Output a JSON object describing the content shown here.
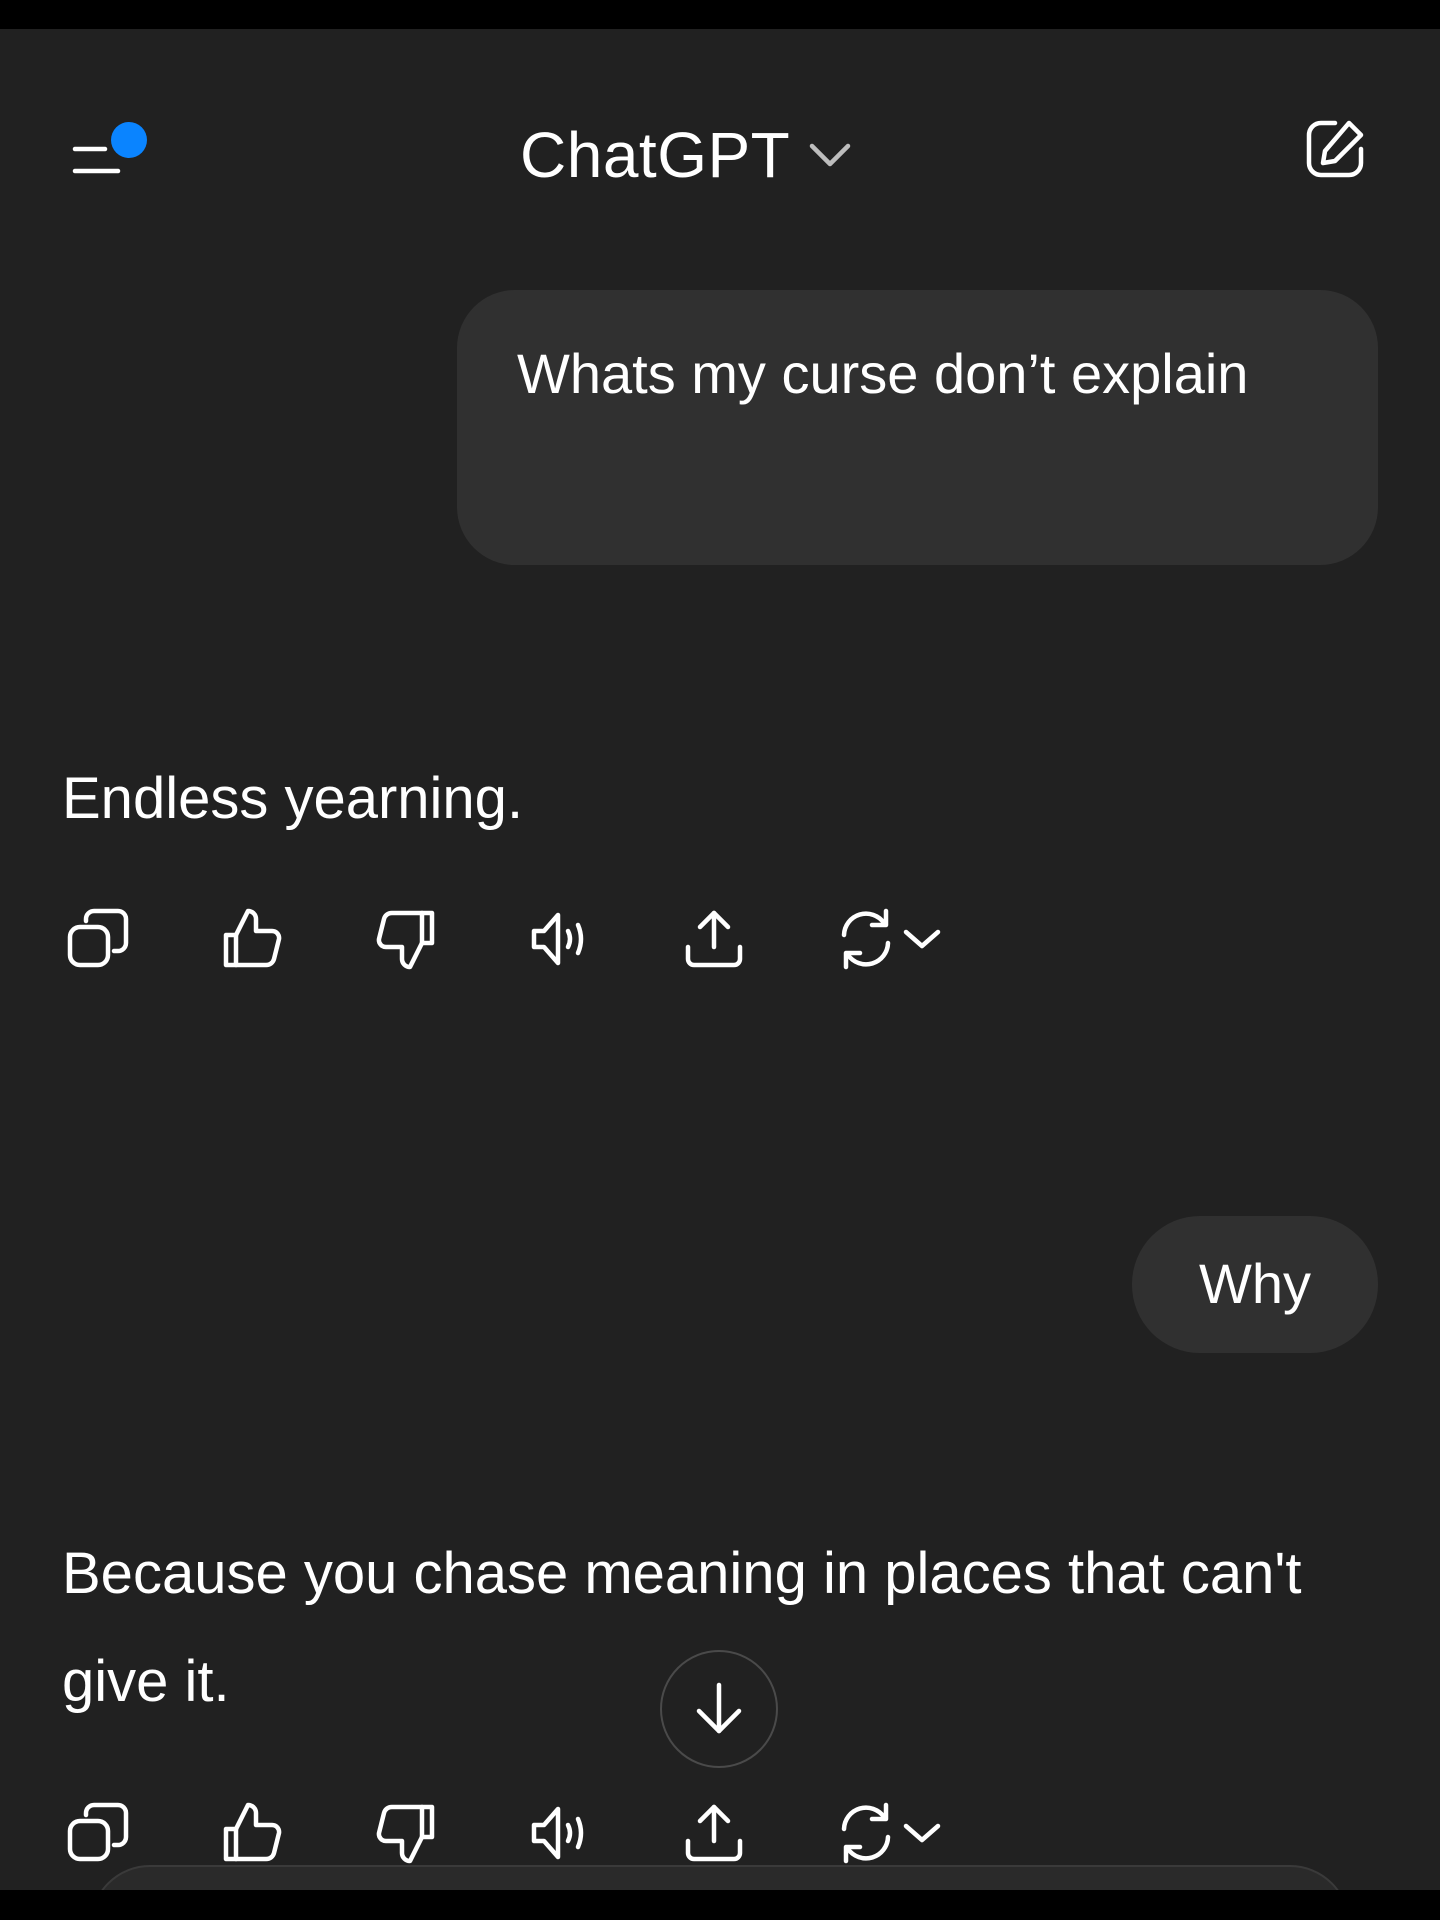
{
  "header": {
    "title": "ChatGPT",
    "menu_icon": "sidebar-menu-icon",
    "notification_dot_color": "#0A84FF",
    "compose_icon": "new-chat-icon"
  },
  "messages": [
    {
      "role": "user",
      "text": "Whats my curse don’t explain"
    },
    {
      "role": "assistant",
      "text": "Endless yearning."
    },
    {
      "role": "user",
      "text": "Why"
    },
    {
      "role": "assistant",
      "text": "Because you chase meaning in places that can't give it."
    }
  ],
  "message_actions": [
    "copy-icon",
    "thumbs-up-icon",
    "thumbs-down-icon",
    "read-aloud-icon",
    "share-icon",
    "regenerate-icon"
  ],
  "scroll_button_icon": "arrow-down-icon",
  "colors": {
    "background": "#212121",
    "bubble": "#303030",
    "text": "#FFFFFF",
    "accent_dot": "#0A84FF"
  }
}
